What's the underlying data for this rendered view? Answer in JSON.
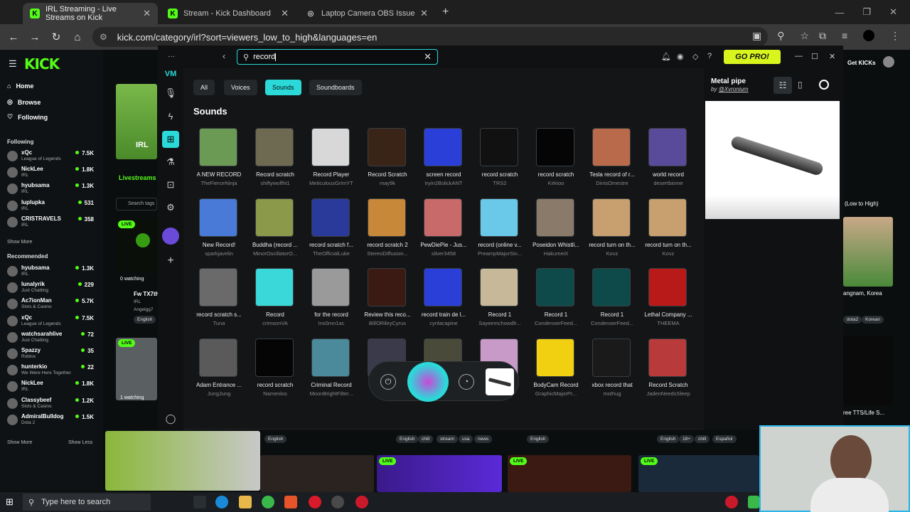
{
  "browser": {
    "tabs": [
      {
        "title": "IRL Streaming - Live Streams on Kick",
        "active": true,
        "fav": "K"
      },
      {
        "title": "Stream - Kick Dashboard",
        "active": false,
        "fav": "K"
      },
      {
        "title": "Laptop Camera OBS Issue",
        "active": false,
        "fav": "◎"
      }
    ],
    "url": "kick.com/category/irl?sort=viewers_low_to_high&languages=en"
  },
  "kick": {
    "logo": "KICK",
    "nav": [
      "Home",
      "Browse",
      "Following"
    ],
    "following_header": "Following",
    "following": [
      {
        "name": "xQc",
        "category": "League of Legends",
        "count": "7.5K"
      },
      {
        "name": "NickLee",
        "category": "IRL",
        "count": "1.8K"
      },
      {
        "name": "hyubsama",
        "category": "IRL",
        "count": "1.3K"
      },
      {
        "name": "luplupka",
        "category": "IRL",
        "count": "531"
      },
      {
        "name": "CRISTRAVELS",
        "category": "IRL",
        "count": "358"
      }
    ],
    "show_more": "Show More",
    "recommended_header": "Recommended",
    "recommended": [
      {
        "name": "hyubsama",
        "category": "IRL",
        "count": "1.3K"
      },
      {
        "name": "lunalyrik",
        "category": "Just Chatting",
        "count": "229"
      },
      {
        "name": "Ac7ionMan",
        "category": "Slots & Casino",
        "count": "5.7K"
      },
      {
        "name": "xQc",
        "category": "League of Legends",
        "count": "7.5K"
      },
      {
        "name": "watchsarahlive",
        "category": "Just Chatting",
        "count": "72"
      },
      {
        "name": "Spazzy",
        "category": "Roblox",
        "count": "35"
      },
      {
        "name": "hunterkio",
        "category": "We Were Here Together",
        "count": "22"
      },
      {
        "name": "NickLee",
        "category": "IRL",
        "count": "1.8K"
      },
      {
        "name": "Classybeef",
        "category": "Slots & Casino",
        "count": "1.2K"
      },
      {
        "name": "AdmiralBulldog",
        "category": "Dota 2",
        "count": "1.5K"
      }
    ],
    "show_less": "Show Less",
    "livestreams_tab": "Livestreams",
    "search_tags_placeholder": "Search tags",
    "irl_label": "IRL",
    "get_kicks": "Get KICKs",
    "sort_label": "(Low to High)",
    "stream_labels": {
      "watching1": "0 watching",
      "fw": "Fw TX7th",
      "irl": "IRL",
      "angel": "Angelgg7",
      "english": "English",
      "watching2": "1 watching",
      "live": "LIVE",
      "angnam": "angnam, Korea",
      "dota2": "dota2",
      "korean": "Korean",
      "tts": "ree TTS/Life S..."
    },
    "bottom_tags": [
      [
        "English"
      ],
      [
        "English",
        "chill",
        "stream",
        "usa",
        "news"
      ],
      [
        "English"
      ],
      [
        "English",
        "18+",
        "chill",
        "Español"
      ]
    ]
  },
  "voicemod": {
    "search_value": "record",
    "go_pro": "GO PRO!",
    "filters": [
      {
        "label": "All",
        "active": false
      },
      {
        "label": "Voices",
        "active": false
      },
      {
        "label": "Sounds",
        "active": true
      },
      {
        "label": "Soundboards",
        "active": false
      }
    ],
    "section_title": "Sounds",
    "sounds": [
      {
        "title": "A NEW RECORD",
        "author": "TheFierceNinja",
        "color": "#6a9a54"
      },
      {
        "title": "Record scratch",
        "author": "shiftywolfht1",
        "color": "#6e6a52"
      },
      {
        "title": "Record Player",
        "author": "MeticulousGrimYT",
        "color": "#d8d8d8"
      },
      {
        "title": "Record Scratch",
        "author": "may9k",
        "color": "#3a2418"
      },
      {
        "title": "screen record",
        "author": "tryin2BslickANT",
        "color": "#2a3fd8"
      },
      {
        "title": "record scratch",
        "author": "TRS2",
        "color": "#111111"
      },
      {
        "title": "record scratch",
        "author": "Kirkioo",
        "color": "#050505"
      },
      {
        "title": "Tesla record of r...",
        "author": "DinisOmestre",
        "color": "#b86a4a"
      },
      {
        "title": "world record",
        "author": "desertbiome",
        "color": "#5a4a9a"
      },
      {
        "title": "New Record!",
        "author": "sparkjavelin",
        "color": "#4a7ad8"
      },
      {
        "title": "Buddha (record ...",
        "author": "MinorOscillatorO...",
        "color": "#8a9a4a"
      },
      {
        "title": "record scratch f...",
        "author": "TheOfficialLuke",
        "color": "#2a3a9a"
      },
      {
        "title": "record scratch 2",
        "author": "StereoDiffusion...",
        "color": "#c8883a"
      },
      {
        "title": "PewDiePie - Jus...",
        "author": "silver3458",
        "color": "#c86a6a"
      },
      {
        "title": "record (online v...",
        "author": "PreampMajorSin...",
        "color": "#6ac8e8"
      },
      {
        "title": "Poseidon Whistli...",
        "author": "HakumeiX",
        "color": "#8a7a6a"
      },
      {
        "title": "record turn on th...",
        "author": "Kovz",
        "color": "#c8a070"
      },
      {
        "title": "record turn on th...",
        "author": "Kovz",
        "color": "#c8a070"
      },
      {
        "title": "record scratch s...",
        "author": "Tuna",
        "color": "#6a6a6a"
      },
      {
        "title": "Record",
        "author": "crimsonVA",
        "color": "#3ad8d8"
      },
      {
        "title": "for the record",
        "author": "Ins0mn1ac",
        "color": "#9a9a9a"
      },
      {
        "title": "Review this reco...",
        "author": "BillORileyCyrus",
        "color": "#3a1a12"
      },
      {
        "title": "record train de l...",
        "author": "cynlacapine",
        "color": "#2a3fd8"
      },
      {
        "title": "Record 1",
        "author": "Sayeemchowdh...",
        "color": "#c8b89a"
      },
      {
        "title": "Record 1",
        "author": "CondenserFeed...",
        "color": "#0f4a4a"
      },
      {
        "title": "Record 1",
        "author": "CondenserFeed...",
        "color": "#0f4a4a"
      },
      {
        "title": "Lethal Company ...",
        "author": "THEEMA",
        "color": "#b81a1a"
      },
      {
        "title": "Adam Entrance ...",
        "author": "JungJung",
        "color": "#5a5a5a"
      },
      {
        "title": "record scratch",
        "author": "Namenlos",
        "color": "#050505"
      },
      {
        "title": "Criminal Record",
        "author": "MoonBrightFilter...",
        "color": "#4a8a9a"
      },
      {
        "title": "",
        "author": "",
        "color": "#3a3a4a"
      },
      {
        "title": "",
        "author": "",
        "color": "#4a4a3a"
      },
      {
        "title": "",
        "author": "",
        "color": "#c89ac8"
      },
      {
        "title": "BodyCam Record",
        "author": "GraphicMajorPr...",
        "color": "#f0d010"
      },
      {
        "title": "xbox record that",
        "author": "mothug",
        "color": "#1a1a1a"
      },
      {
        "title": "Record Scratch",
        "author": "JadenNeedsSleep",
        "color": "#b83a3a"
      }
    ],
    "detail": {
      "title": "Metal pipe",
      "by": "by",
      "author": "@Xvronium"
    }
  },
  "taskbar": {
    "search_placeholder": "Type here to search"
  }
}
